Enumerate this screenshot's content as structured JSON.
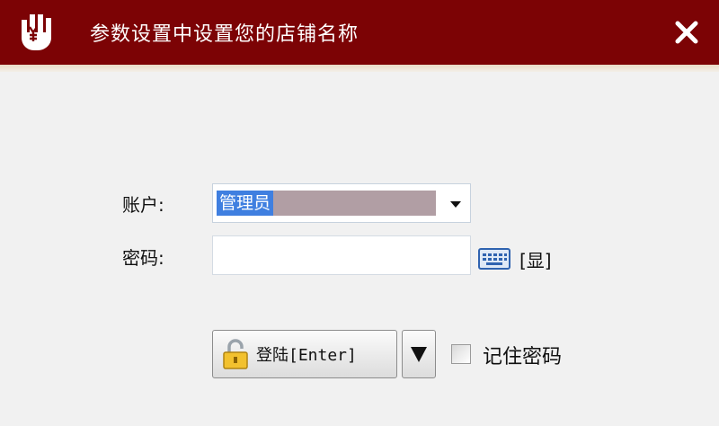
{
  "window": {
    "title": "参数设置中设置您的店铺名称",
    "app_icon": "hand-yen-logo-icon",
    "close_icon": "close-icon",
    "accent_color": "#7c0305"
  },
  "form": {
    "account_label": "账户:",
    "account_value": "管理员",
    "account_dropdown_icon": "chevron-down-icon",
    "password_label": "密码:",
    "password_value": "",
    "keyboard_icon": "keyboard-icon",
    "show_password_label": "[显]"
  },
  "actions": {
    "login_label": "登陆[Enter]",
    "login_icon": "unlock-icon",
    "login_menu_icon": "triangle-down-icon",
    "remember_label": "记住密码",
    "remember_checked": false
  }
}
